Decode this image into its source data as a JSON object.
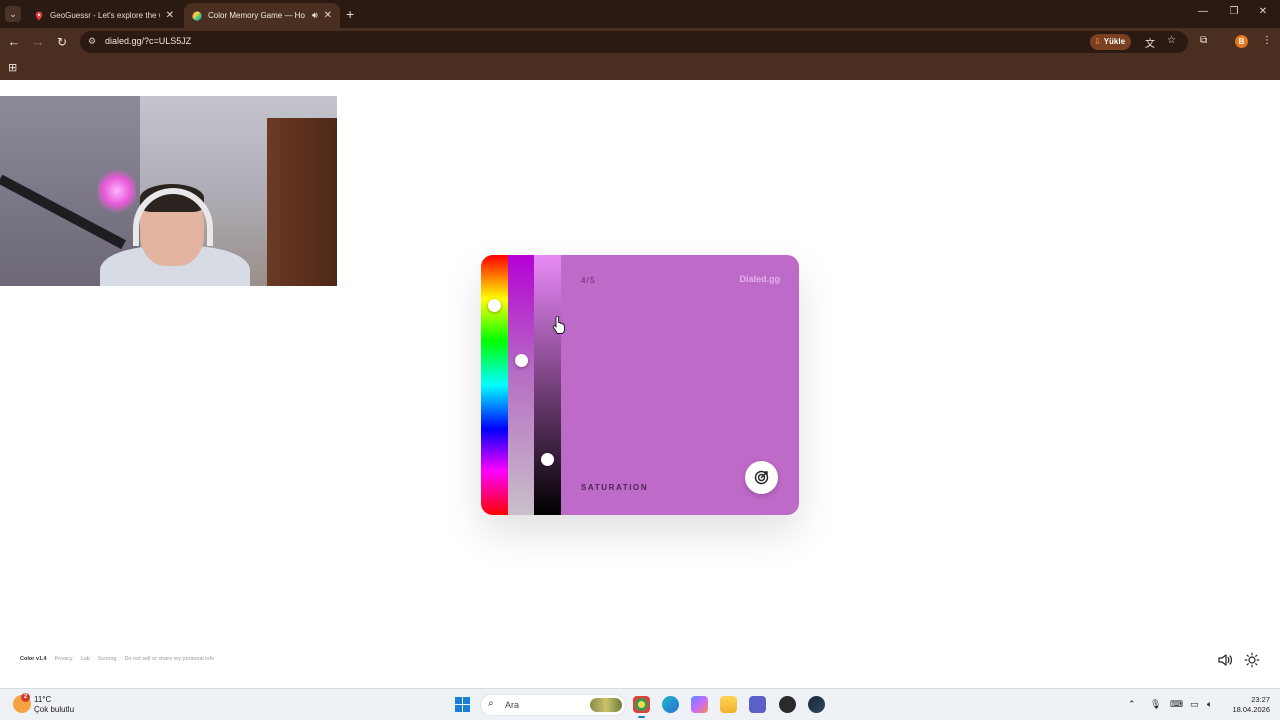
{
  "browser": {
    "tabs": [
      {
        "title": "GeoGuessr - Let's explore the w",
        "active": false,
        "icon": "geoguessr-pin-icon"
      },
      {
        "title": "Color Memory Game — Ho",
        "active": true,
        "icon": "color-wheel-icon",
        "audio": true
      }
    ],
    "url": "dialed.gg/?c=ULS5JZ",
    "install_label": "Yükle",
    "profile_initial": "B"
  },
  "game": {
    "counter": "4/5",
    "brand": "Dialed.gg",
    "mode_label": "SATURATION",
    "current_color": "#bd6ac8",
    "hue_level": 0.82,
    "saturation_level": 0.6,
    "brightness_level": 0.2
  },
  "footer": {
    "version": "Color v1.4",
    "links": [
      "Privacy",
      "Lab",
      "Scoring",
      "Do not sell or share my personal info"
    ]
  },
  "taskbar": {
    "weather_temp": "11°C",
    "weather_desc": "Çok bulutlu",
    "weather_badge": "2",
    "search_placeholder": "Ara",
    "time": "23:27",
    "date": "18.04.2026"
  }
}
